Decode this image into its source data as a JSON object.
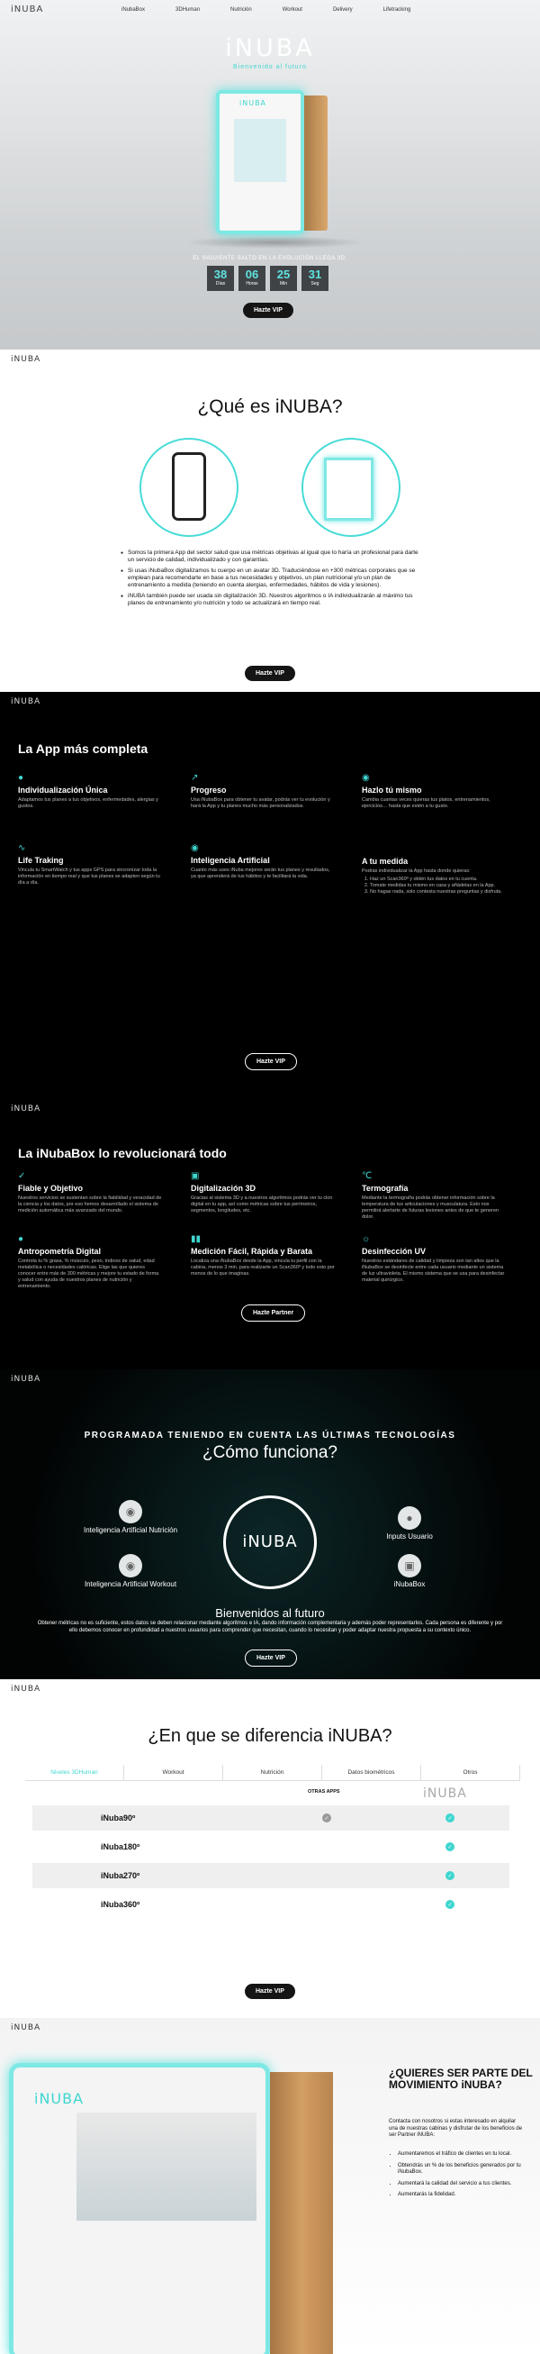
{
  "nav": {
    "logo": "iNUBA",
    "items": [
      "iNubaBox",
      "3DHuman",
      "Nutrición",
      "Workout",
      "Delivery",
      "Lifetracking"
    ]
  },
  "hero": {
    "brand": "iNUBA",
    "brand_sub": "Bienvenido al futuro",
    "box_text": "iNUBA",
    "tagline": "EL SIGUIENTE SALTO EN LA EVOLUCIÓN LLEGA 3D.",
    "countdown": [
      {
        "value": "38",
        "unit": "Días"
      },
      {
        "value": "06",
        "unit": "Horas"
      },
      {
        "value": "25",
        "unit": "Min"
      },
      {
        "value": "31",
        "unit": "Seg"
      }
    ],
    "cta": "Hazte VIP"
  },
  "que": {
    "logo": "iNUBA",
    "title": "¿Qué es iNUBA?",
    "bullets": [
      "Somos la primera App del sector salud que usa métricas objetivas al igual que lo haría un profesional para darte un servicio de calidad, individualizado y con garantías.",
      "Si usas iNubaBox digitalizamos tu cuerpo en un avatar 3D. Traduciéndose en +300 métricas corporales que se emplean para recomendarte en base a tus necesidades y objetivos, un plan nutricional y/o un plan de entrenamiento a medida (teniendo en cuenta alergias, enfermedades, hábitos de vida y lesiones).",
      "iNUBA también puede ser usada sin digitalización 3D. Nuestros algoritmos o IA individualizarán al máximo tus planes de entrenamiento y/o nutrición y todo se actualizará en tiempo real."
    ],
    "cta": "Hazte VIP"
  },
  "app": {
    "logo": "iNUBA",
    "title": "La App más completa",
    "features": [
      {
        "icon": "user-icon",
        "title": "Individualización Única",
        "text": "Adaptamos tus planes a tus objetivos, enfermedades, alergias y gustos."
      },
      {
        "icon": "chart-icon",
        "title": "Progreso",
        "text": "Usa iNubaBox para obtener tu avatar, podrás ver tu evolución y hará la App y tu planes mucho más personalizados."
      },
      {
        "icon": "person-icon",
        "title": "Hazlo tú mismo",
        "text": "Cambia cuantas veces quieras tus platos, entrenamientos, ejercicios… hasta que estén a tu gusto."
      },
      {
        "icon": "pulse-icon",
        "title": "Life Traking",
        "text": "Vincula tu SmartWatch y tus apps GPS para sincronizar toda la información en tiempo real y que tus planes se adapten según tu día a día."
      },
      {
        "icon": "brain-icon",
        "title": "Inteligencia Artificial",
        "text": "Cuanto más uses iNuba mejores serán tus planes y resultados, ya que aprenderá de tus hábitos y te facilitará la vida."
      },
      {
        "icon": "",
        "title": "A tu medida",
        "text": "Podrás individualizar la App hasta donde quieras:",
        "list": [
          "Haz un Scan360º y obtén tus datos en tu cuenta.",
          "Tomate medidas tu mismo en casa y añádelas en la App.",
          "No hagas nada, solo contesta nuestras preguntas y disfruta."
        ]
      }
    ],
    "cta": "Hazte VIP"
  },
  "box": {
    "logo": "iNUBA",
    "title": "La iNubaBox lo revolucionará todo",
    "features": [
      {
        "icon": "thumb-icon",
        "title": "Fiable y Objetivo",
        "text": "Nuestros servicios se sustentan sobre la fiabilidad y veracidad de la ciencia y los datos, por eso hemos desarrollado el sistema de medición automática más avanzado del mundo."
      },
      {
        "icon": "cube-icon",
        "title": "Digitalización 3D",
        "text": "Gracias al sistema 3D y a nuestros algoritmos podrás ver tu clon digital en tu app, así como métricas sobre tus perímetros, segmentos, longitudes, etc."
      },
      {
        "icon": "thermometer-icon",
        "title": "Termografía",
        "text": "Mediante la termografía podrás obtener información sobre la temperatura de tus articulaciones y musculatura. Esto nos permitirá alertarte de futuras lesiones antes de que te generen dolor."
      },
      {
        "icon": "body-icon",
        "title": "Antropometría Digital",
        "text": "Controla tu % grasa, % músculo, peso, índices de salud, edad metabólica o necesidades calóricas. Elige las que quieres conocer entre más de 300 métricas y mejore tu estado de forma y salud con ayuda de nuestros planes de nutrición y entrenamiento."
      },
      {
        "icon": "bars-icon",
        "title": "Medición Fácil, Rápida y Barata",
        "text": "Localiza una iNubaBox desde la App, vincula tu perfil con la cabina, menos 3 min. para realizarte un Scan360º y todo esto por menos de lo que imaginas."
      },
      {
        "icon": "uv-icon",
        "title": "Desinfección UV",
        "text": "Nuestros estándares de calidad y limpieza son tan altos que la iNubaBox se desinfecte entre cada usuario mediante un sistema de luz ultravioleta. El mismo sistema que se usa para desinfectar material quirúrgico."
      }
    ],
    "cta": "Hazte Partner"
  },
  "como": {
    "logo": "iNUBA",
    "pre": "PROGRAMADA TENIENDO EN CUENTA LAS ÚLTIMAS TECNOLOGÍAS",
    "title": "¿Cómo funciona?",
    "center": "iNUBA",
    "items": [
      "Inteligencia Artificial Nutrición",
      "Inteligencia Artificial Workout",
      "Inputs Usuario",
      "iNubaBox"
    ],
    "subtitle": "Bienvenidos al futuro",
    "text": "Obtener métricas no es suficiente, estos datos se deben relacionar mediante algoritmos e IA, dando información complementaria y además poder representarlos. Cada persona es diferente y por ello debemos conocer en profundidad a nuestros usuarios para comprender que necesitan, cuando lo necesitan y poder adaptar nuestra propuesta a su contexto único.",
    "cta": "Hazte VIP"
  },
  "dif": {
    "logo": "iNUBA",
    "title": "¿En que se diferencia iNUBA?",
    "tabs": [
      "Niveles 3DHuman",
      "Workout",
      "Nutrición",
      "Datos biométricos",
      "Otros"
    ],
    "col_others": "OTRAS APPS",
    "col_inuba": "iNUBA",
    "rows": [
      "iNuba90º",
      "iNuba180º",
      "iNuba270º",
      "iNuba360º"
    ],
    "colors": {
      "accent": "#3fd6d0",
      "gray": "#9a9a9a"
    },
    "cta": "Hazte VIP"
  },
  "partner": {
    "logo": "iNUBA",
    "box_logo": "iNUBA",
    "title": "¿QUIERES SER PARTE DEL MOVIMIENTO iNUBA?",
    "text": "Contacta con nosotros si estas interesado en alquilar una de nuestras cabinas y disfrutar de los beneficios de ser Partner iNUBA:",
    "benefits": [
      "Aumentaremos el tráfico de clientes en tu local.",
      "Obtendrás un % de los beneficios generados por tu iNubaBox.",
      "Aumentará la calidad del servicio a tus clientes.",
      "Aumentarás la fidelidad."
    ]
  }
}
